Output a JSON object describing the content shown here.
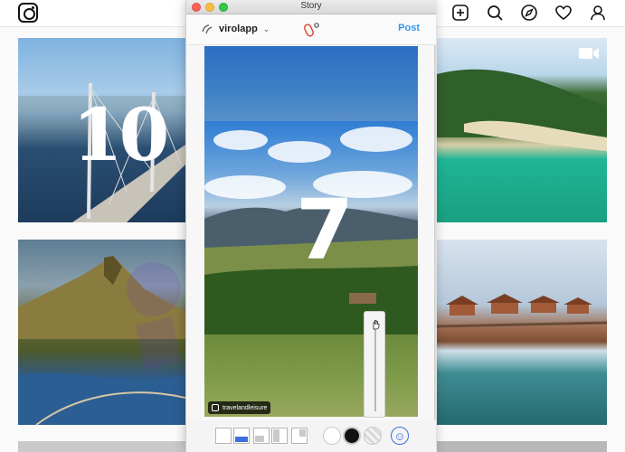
{
  "story_window": {
    "title": "Story",
    "account_name": "virolapp",
    "post_label": "Post",
    "story_number": "7",
    "credit_text": "travelandleisure"
  },
  "feed": {
    "tiles": [
      {
        "name": "bridge",
        "number": "10"
      },
      {
        "name": "mountain"
      },
      {
        "name": "beach",
        "has_video": true
      },
      {
        "name": "huts"
      }
    ]
  },
  "colors": {
    "accent": "#3897f0",
    "layout_selected": "#3b6fe0",
    "color_white": "#ffffff",
    "color_black": "#000000"
  },
  "icons": [
    "instagram-logo-icon",
    "new-post-icon",
    "search-icon",
    "explore-compass-icon",
    "heart-icon",
    "profile-icon",
    "video-icon",
    "clip-icon",
    "emoji-icon"
  ]
}
